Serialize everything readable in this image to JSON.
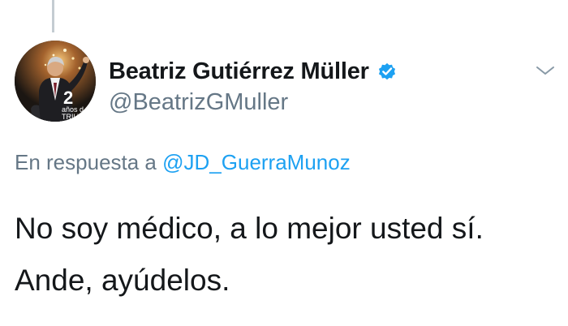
{
  "author": {
    "display_name": "Beatriz Gutiérrez Müller",
    "handle": "@BeatrizGMuller",
    "verified": true,
    "avatar_badge_number": "2",
    "avatar_badge_line1": "años d",
    "avatar_badge_line2": "TRIUN"
  },
  "reply": {
    "prefix": "En respuesta a",
    "mention": "@JD_GuerraMunoz"
  },
  "tweet": {
    "lines": [
      "No soy médico, a lo mejor usted sí.",
      "Ande, ayúdelos."
    ]
  },
  "icons": {
    "verified": "verified-badge-icon",
    "menu": "chevron-down-icon"
  },
  "colors": {
    "text": "#14171a",
    "secondary": "#657786",
    "link": "#1da1f2",
    "verified": "#1da1f2"
  }
}
